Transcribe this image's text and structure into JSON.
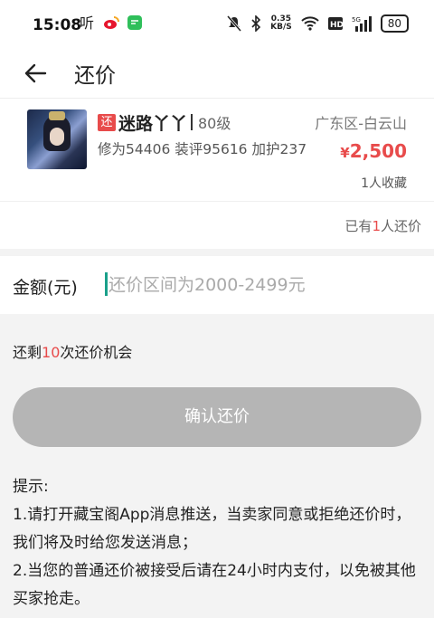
{
  "status_bar": {
    "time": "15:08",
    "speed_value": "0.35",
    "speed_unit": "KB/S",
    "network": "5G",
    "battery": "80"
  },
  "nav": {
    "title": "还价"
  },
  "item": {
    "tag": "还",
    "name": "迷路丫丫",
    "level": "80级",
    "stats": "修为54406 装评95616 加护237",
    "region": "广东区-白云山",
    "price_symbol": "¥",
    "price": "2,500",
    "favorites": "1人收藏"
  },
  "offers": {
    "prefix": "已有",
    "count": "1",
    "suffix": "人还价"
  },
  "amount": {
    "label": "金额(元)",
    "placeholder": "还价区间为2000-2499元",
    "value": ""
  },
  "remaining": {
    "prefix": "还剩",
    "count": "10",
    "suffix": "次还价机会"
  },
  "confirm_label": "确认还价",
  "tips": {
    "title": "提示:",
    "line1": "1.请打开藏宝阁App消息推送，当卖家同意或拒绝还价时，我们将及时给您发送消息；",
    "line2": "2.当您的普通还价被接受后请在24小时内支付，以免被其他买家抢走。"
  },
  "colors": {
    "accent": "#e84b4b",
    "button_disabled": "#b5b5b5",
    "cursor": "#1aa08a"
  }
}
